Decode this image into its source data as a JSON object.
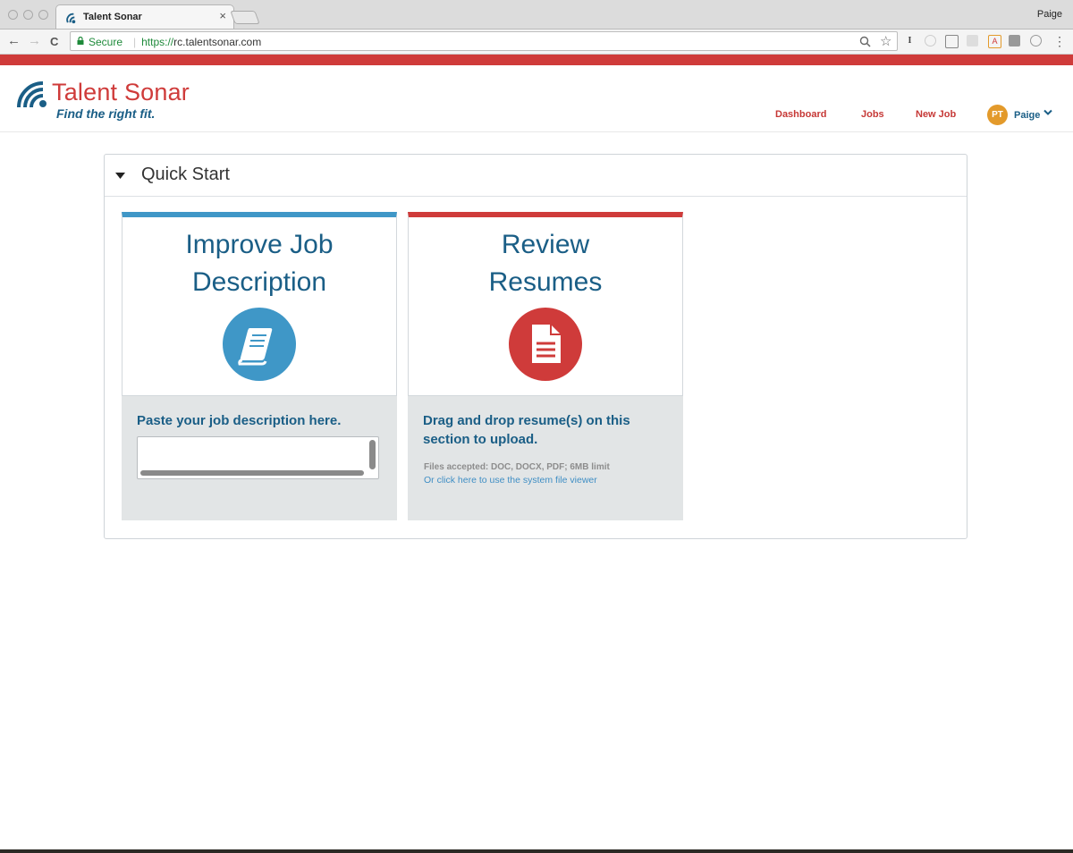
{
  "browser": {
    "tab_title": "Talent Sonar",
    "tab_close": "×",
    "profile_name": "Paige",
    "secure_label": "Secure",
    "url_scheme": "https://",
    "url_host": "rc.talentsonar.com",
    "back_glyph": "←",
    "forward_glyph": "→",
    "reload_glyph": "C",
    "menu_glyph": "⋮",
    "accent_stripe": "#cf3b3a"
  },
  "brand": {
    "name": "Talent Sonar",
    "tagline": "Find the right fit."
  },
  "nav": {
    "items": [
      "Dashboard",
      "Jobs",
      "New Job"
    ],
    "user_initials": "PT",
    "user_name": "Paige"
  },
  "quick_start": {
    "title": "Quick Start",
    "cards": [
      {
        "heading_line1": "Improve Job",
        "heading_line2": "Description",
        "icon": "book-icon",
        "accent": "#3f97c7",
        "prompt": "Paste your job description here.",
        "input_value": ""
      },
      {
        "heading_line1": "Review",
        "heading_line2": "Resumes",
        "icon": "document-icon",
        "accent": "#cf3b3a",
        "prompt_line1": "Drag and drop resume(s) on this",
        "prompt_line2": "section to upload.",
        "files_note": "Files accepted: DOC, DOCX, PDF; 6MB limit",
        "file_link": "Or click here to use the system file viewer"
      }
    ]
  }
}
